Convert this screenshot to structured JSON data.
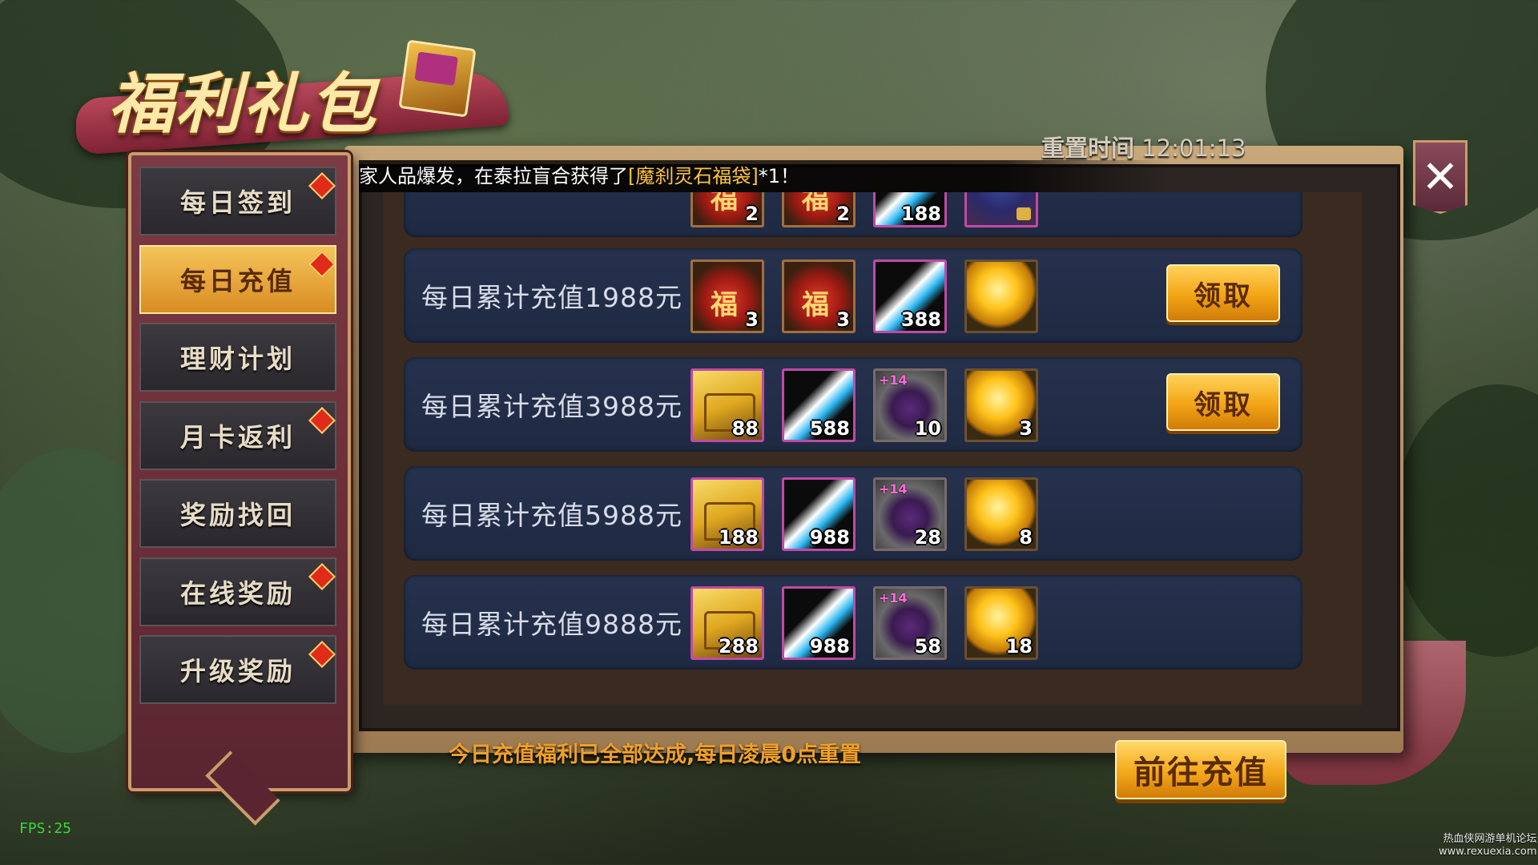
{
  "title": "福利礼包",
  "reset": {
    "label": "重置时间",
    "time": "12:01:13"
  },
  "marquee": {
    "prefix": "家人品爆发，在泰拉盲合获得了",
    "item": "[魔刹灵石福袋]",
    "suffix": "*1！"
  },
  "sidebar": {
    "items": [
      {
        "label": "每日签到",
        "badge": true,
        "active": false
      },
      {
        "label": "每日充值",
        "badge": true,
        "active": true
      },
      {
        "label": "理财计划",
        "badge": false,
        "active": false
      },
      {
        "label": "月卡返利",
        "badge": true,
        "active": false
      },
      {
        "label": "奖励找回",
        "badge": false,
        "active": false
      },
      {
        "label": "在线奖励",
        "badge": true,
        "active": false
      },
      {
        "label": "升级奖励",
        "badge": true,
        "active": false
      }
    ]
  },
  "rows": [
    {
      "label": "",
      "items": [
        {
          "icon": "lucky-bag",
          "qty": "2"
        },
        {
          "icon": "lucky-bag",
          "qty": "2"
        },
        {
          "icon": "blade-slash",
          "qty": "188"
        },
        {
          "icon": "locked-orb",
          "qty": ""
        }
      ],
      "button": ""
    },
    {
      "label": "每日累计充值1988元",
      "items": [
        {
          "icon": "lucky-bag",
          "qty": "3"
        },
        {
          "icon": "lucky-bag",
          "qty": "3"
        },
        {
          "icon": "blade-slash",
          "qty": "388"
        },
        {
          "icon": "gold-coin",
          "qty": ""
        }
      ],
      "button": "领取"
    },
    {
      "label": "每日累计充值3988元",
      "items": [
        {
          "icon": "treasure-chest",
          "qty": "88"
        },
        {
          "icon": "blade-slash",
          "qty": "588"
        },
        {
          "icon": "enhance-scroll",
          "plus": "+14",
          "qty": "10"
        },
        {
          "icon": "gold-coin",
          "qty": "3"
        }
      ],
      "button": "领取"
    },
    {
      "label": "每日累计充值5988元",
      "items": [
        {
          "icon": "treasure-chest",
          "qty": "188"
        },
        {
          "icon": "blade-slash",
          "qty": "988"
        },
        {
          "icon": "enhance-scroll",
          "plus": "+14",
          "qty": "28"
        },
        {
          "icon": "gold-coin",
          "qty": "8"
        }
      ],
      "button": ""
    },
    {
      "label": "每日累计充值9888元",
      "items": [
        {
          "icon": "treasure-chest",
          "qty": "288"
        },
        {
          "icon": "blade-slash",
          "qty": "988"
        },
        {
          "icon": "enhance-scroll",
          "plus": "+14",
          "qty": "58"
        },
        {
          "icon": "gold-coin",
          "qty": "18"
        }
      ],
      "button": ""
    }
  ],
  "status_text": "今日充值福利已全部达成,每日凌晨0点重置",
  "recharge_button": "前往充值",
  "close_icon": "close-icon",
  "fps": "FPS:25",
  "watermark": {
    "line1": "热血侠网游单机论坛",
    "line2": "www.rexuexia.com"
  },
  "colors": {
    "accent_gold": "#f3a414",
    "panel_row": "#26324e",
    "badge_red": "#e02a1a",
    "highlight_text": "#ffc43a"
  }
}
